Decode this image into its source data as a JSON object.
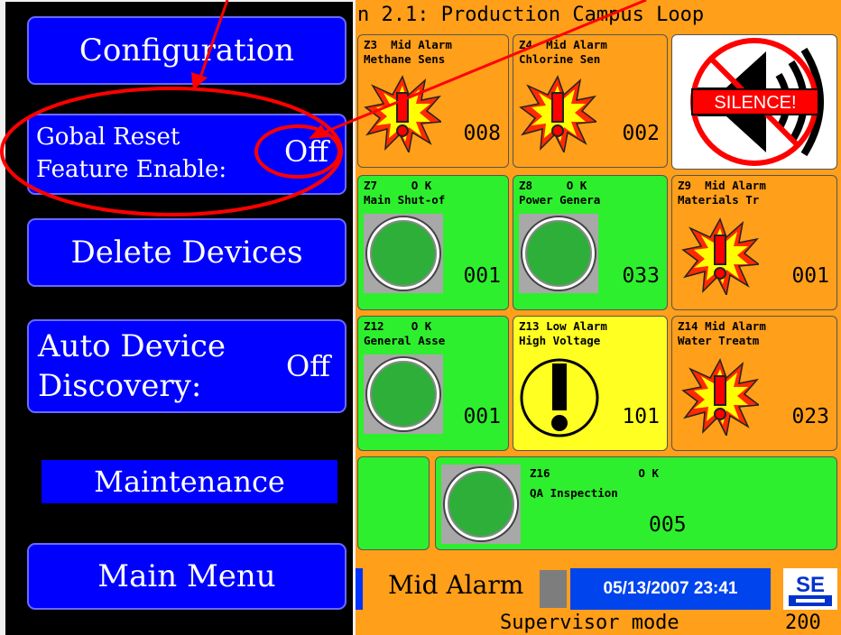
{
  "sidebar": {
    "configuration": "Configuration",
    "global_reset_line1": "Gobal Reset",
    "global_reset_line2": "Feature Enable:",
    "global_reset_value": "Off",
    "delete_devices": "Delete Devices",
    "auto_discovery_line1": "Auto Device",
    "auto_discovery_line2": "Discovery:",
    "auto_discovery_value": "Off",
    "maintenance": "Maintenance",
    "main_menu": "Main Menu"
  },
  "panel": {
    "header": "n 2.1: Production Campus Loop",
    "tiles": [
      {
        "zone": "Z3",
        "status": "Mid Alarm",
        "name": "Methane Sens",
        "value": "008",
        "icon": "alarm-burst-icon"
      },
      {
        "zone": "Z4",
        "status": "Mid Alarm",
        "name": "Chlorine Sen",
        "value": "002",
        "icon": "alarm-burst-icon"
      },
      {
        "zone": "Z7",
        "status": "O K",
        "name": "Main Shut-of",
        "value": "001",
        "icon": "green-lamp-icon"
      },
      {
        "zone": "Z8",
        "status": "O K",
        "name": "Power Genera",
        "value": "033",
        "icon": "green-lamp-icon"
      },
      {
        "zone": "Z9",
        "status": "Mid Alarm",
        "name": "Materials Tr",
        "value": "001",
        "icon": "alarm-burst-icon"
      },
      {
        "zone": "Z12",
        "status": "O K",
        "name": "General Asse",
        "value": "001",
        "icon": "green-lamp-icon"
      },
      {
        "zone": "Z13",
        "status": "Low Alarm",
        "name": "High Voltage",
        "value": "101",
        "icon": "exclamation-circle-icon"
      },
      {
        "zone": "Z14",
        "status": "Mid Alarm",
        "name": "Water Treatm",
        "value": "023",
        "icon": "alarm-burst-icon"
      },
      {
        "zone": "Z16",
        "status": "O K",
        "name": "QA Inspection",
        "value": "005",
        "icon": "green-lamp-icon"
      }
    ],
    "silence_label": "SILENCE!",
    "footer": {
      "alarm_level": "Mid Alarm",
      "datetime": "05/13/2007 23:41",
      "logo": "SE",
      "mode": "Supervisor mode",
      "code": "200"
    }
  },
  "colors": {
    "button_blue": "#0000ff",
    "panel_orange": "#ff9f1a",
    "ok_green": "#2eef2e",
    "low_alarm_yellow": "#ffff22",
    "annotation_red": "#ff0000"
  }
}
